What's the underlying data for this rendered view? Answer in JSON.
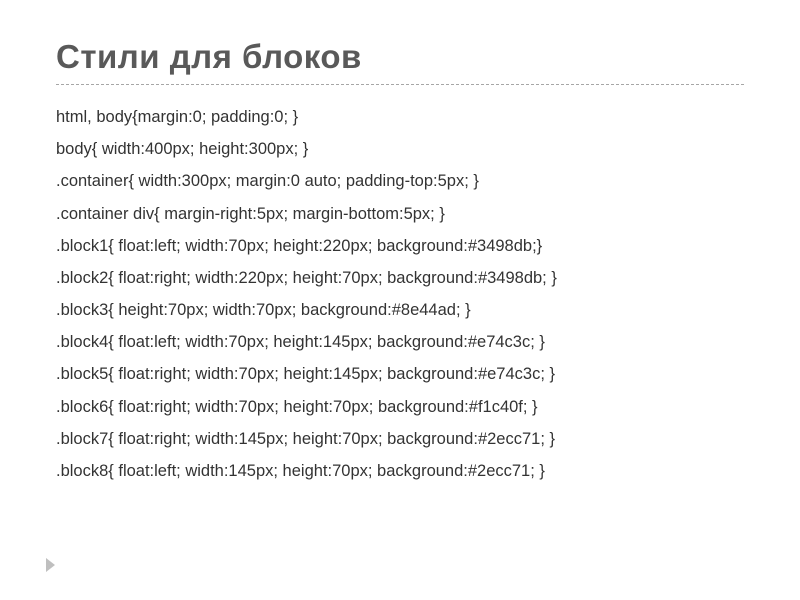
{
  "slide": {
    "title": "Стили для блоков",
    "lines": [
      "html, body{margin:0; padding:0; }",
      "body{ width:400px; height:300px; }",
      ".container{ width:300px; margin:0 auto; padding-top:5px; }",
      ".container div{ margin-right:5px; margin-bottom:5px; }",
      ".block1{ float:left; width:70px; height:220px; background:#3498db;}",
      ".block2{ float:right; width:220px; height:70px; background:#3498db; }",
      ".block3{ height:70px; width:70px; background:#8e44ad; }",
      ".block4{ float:left; width:70px; height:145px; background:#e74c3c; }",
      ".block5{ float:right; width:70px; height:145px; background:#e74c3c; }",
      ".block6{ float:right; width:70px; height:70px; background:#f1c40f; }",
      ".block7{ float:right; width:145px; height:70px; background:#2ecc71; }",
      ".block8{ float:left; width:145px; height:70px; background:#2ecc71; }"
    ]
  }
}
